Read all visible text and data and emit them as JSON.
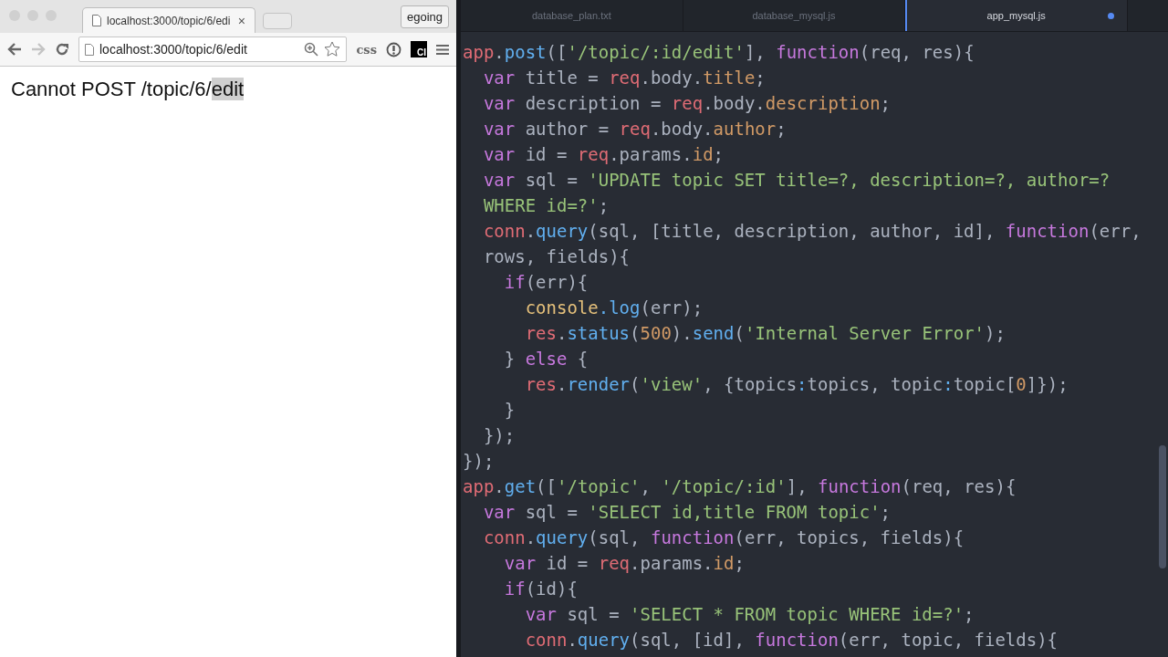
{
  "browser": {
    "tab": {
      "title": "localhost:3000/topic/6/edi",
      "close": "×"
    },
    "profile": "egoing",
    "address": "localhost:3000/topic/6/edit",
    "extensions": [
      {
        "kind": "text",
        "label": "css"
      },
      {
        "kind": "badge",
        "label": "CI"
      }
    ],
    "page": {
      "message": "Cannot POST /topic/6/",
      "selected_text": "edit"
    }
  },
  "editor": {
    "tabs": [
      {
        "label": "database_plan.txt",
        "selected": false,
        "modified": false
      },
      {
        "label": "database_mysql.js",
        "selected": false,
        "modified": false
      },
      {
        "label": "app_mysql.js",
        "selected": true,
        "modified": true
      }
    ],
    "lines": [
      [
        {
          "kind": "var",
          "text": "app"
        },
        {
          "kind": "p",
          "text": "."
        },
        {
          "kind": "fn",
          "text": "post"
        },
        {
          "kind": "p",
          "text": "(["
        },
        {
          "kind": "str",
          "text": "'/topic/:id/edit'"
        },
        {
          "kind": "p",
          "text": "], "
        },
        {
          "kind": "kw",
          "text": "function"
        },
        {
          "kind": "p",
          "text": "(req, res){"
        }
      ],
      [
        {
          "kind": "kw",
          "text": "  var"
        },
        {
          "kind": "p",
          "text": " title = "
        },
        {
          "kind": "var",
          "text": "req"
        },
        {
          "kind": "p",
          "text": ".body."
        },
        {
          "kind": "prop",
          "text": "title"
        },
        {
          "kind": "p",
          "text": ";"
        }
      ],
      [
        {
          "kind": "kw",
          "text": "  var"
        },
        {
          "kind": "p",
          "text": " description = "
        },
        {
          "kind": "var",
          "text": "req"
        },
        {
          "kind": "p",
          "text": ".body."
        },
        {
          "kind": "prop",
          "text": "description"
        },
        {
          "kind": "p",
          "text": ";"
        }
      ],
      [
        {
          "kind": "kw",
          "text": "  var"
        },
        {
          "kind": "p",
          "text": " author = "
        },
        {
          "kind": "var",
          "text": "req"
        },
        {
          "kind": "p",
          "text": ".body."
        },
        {
          "kind": "prop",
          "text": "author"
        },
        {
          "kind": "p",
          "text": ";"
        }
      ],
      [
        {
          "kind": "kw",
          "text": "  var"
        },
        {
          "kind": "p",
          "text": " id = "
        },
        {
          "kind": "var",
          "text": "req"
        },
        {
          "kind": "p",
          "text": ".params."
        },
        {
          "kind": "prop",
          "text": "id"
        },
        {
          "kind": "p",
          "text": ";"
        }
      ],
      [
        {
          "kind": "kw",
          "text": "  var"
        },
        {
          "kind": "p",
          "text": " sql = "
        },
        {
          "kind": "str",
          "text": "'UPDATE topic SET title=?, description=?, author=?"
        }
      ],
      [
        {
          "kind": "str",
          "text": "  WHERE id=?'"
        },
        {
          "kind": "p",
          "text": ";"
        }
      ],
      [
        {
          "kind": "var",
          "text": "  conn"
        },
        {
          "kind": "p",
          "text": "."
        },
        {
          "kind": "fn",
          "text": "query"
        },
        {
          "kind": "p",
          "text": "(sql, [title, description, author, id], "
        },
        {
          "kind": "kw",
          "text": "function"
        },
        {
          "kind": "p",
          "text": "(err,"
        }
      ],
      [
        {
          "kind": "p",
          "text": "  rows, fields){"
        }
      ],
      [
        {
          "kind": "kw",
          "text": "    if"
        },
        {
          "kind": "p",
          "text": "(err){"
        }
      ],
      [
        {
          "kind": "cls",
          "text": "      console"
        },
        {
          "kind": "fn",
          "text": ".log"
        },
        {
          "kind": "p",
          "text": "(err);"
        }
      ],
      [
        {
          "kind": "var",
          "text": "      res"
        },
        {
          "kind": "p",
          "text": "."
        },
        {
          "kind": "fn",
          "text": "status"
        },
        {
          "kind": "p",
          "text": "("
        },
        {
          "kind": "num",
          "text": "500"
        },
        {
          "kind": "p",
          "text": ")."
        },
        {
          "kind": "fn",
          "text": "send"
        },
        {
          "kind": "p",
          "text": "("
        },
        {
          "kind": "str",
          "text": "'Internal Server Error'"
        },
        {
          "kind": "p",
          "text": ");"
        }
      ],
      [
        {
          "kind": "p",
          "text": "    } "
        },
        {
          "kind": "kw",
          "text": "else"
        },
        {
          "kind": "p",
          "text": " {"
        }
      ],
      [
        {
          "kind": "var",
          "text": "      res"
        },
        {
          "kind": "p",
          "text": "."
        },
        {
          "kind": "fn",
          "text": "render"
        },
        {
          "kind": "p",
          "text": "("
        },
        {
          "kind": "str",
          "text": "'view'"
        },
        {
          "kind": "p",
          "text": ", {topics"
        },
        {
          "kind": "fn",
          "text": ":"
        },
        {
          "kind": "p",
          "text": "topics, topic"
        },
        {
          "kind": "fn",
          "text": ":"
        },
        {
          "kind": "p",
          "text": "topic["
        },
        {
          "kind": "num",
          "text": "0"
        },
        {
          "kind": "p",
          "text": "]});"
        }
      ],
      [
        {
          "kind": "p",
          "text": "    }"
        }
      ],
      [
        {
          "kind": "p",
          "text": "  });"
        }
      ],
      [
        {
          "kind": "p",
          "text": "});"
        }
      ],
      [
        {
          "kind": "var",
          "text": "app"
        },
        {
          "kind": "p",
          "text": "."
        },
        {
          "kind": "fn",
          "text": "get"
        },
        {
          "kind": "p",
          "text": "(["
        },
        {
          "kind": "str",
          "text": "'/topic'"
        },
        {
          "kind": "p",
          "text": ", "
        },
        {
          "kind": "str",
          "text": "'/topic/:id'"
        },
        {
          "kind": "p",
          "text": "], "
        },
        {
          "kind": "kw",
          "text": "function"
        },
        {
          "kind": "p",
          "text": "(req, res){"
        }
      ],
      [
        {
          "kind": "kw",
          "text": "  var"
        },
        {
          "kind": "p",
          "text": " sql = "
        },
        {
          "kind": "str",
          "text": "'SELECT id,title FROM topic'"
        },
        {
          "kind": "p",
          "text": ";"
        }
      ],
      [
        {
          "kind": "var",
          "text": "  conn"
        },
        {
          "kind": "p",
          "text": "."
        },
        {
          "kind": "fn",
          "text": "query"
        },
        {
          "kind": "p",
          "text": "(sql, "
        },
        {
          "kind": "kw",
          "text": "function"
        },
        {
          "kind": "p",
          "text": "(err, topics, fields){"
        }
      ],
      [
        {
          "kind": "kw",
          "text": "    var"
        },
        {
          "kind": "p",
          "text": " id = "
        },
        {
          "kind": "var",
          "text": "req"
        },
        {
          "kind": "p",
          "text": ".params."
        },
        {
          "kind": "prop",
          "text": "id"
        },
        {
          "kind": "p",
          "text": ";"
        }
      ],
      [
        {
          "kind": "kw",
          "text": "    if"
        },
        {
          "kind": "p",
          "text": "(id){"
        }
      ],
      [
        {
          "kind": "kw",
          "text": "      var"
        },
        {
          "kind": "p",
          "text": " sql = "
        },
        {
          "kind": "str",
          "text": "'SELECT * FROM topic WHERE id=?'"
        },
        {
          "kind": "p",
          "text": ";"
        }
      ],
      [
        {
          "kind": "var",
          "text": "      conn"
        },
        {
          "kind": "p",
          "text": "."
        },
        {
          "kind": "fn",
          "text": "query"
        },
        {
          "kind": "p",
          "text": "(sql, [id], "
        },
        {
          "kind": "kw",
          "text": "function"
        },
        {
          "kind": "p",
          "text": "(err, topic, fields){"
        }
      ]
    ]
  }
}
